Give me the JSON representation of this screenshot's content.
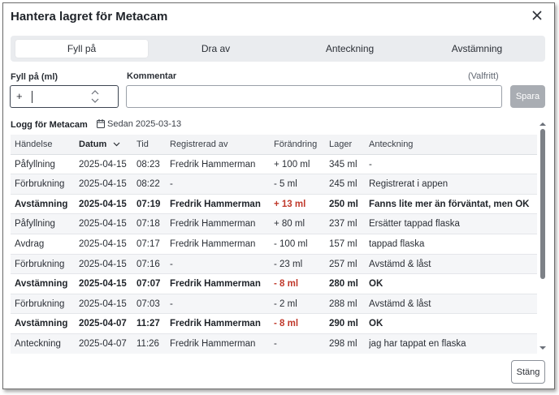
{
  "dialog": {
    "title": "Hantera lagret för Metacam",
    "close_label": "Stäng"
  },
  "tabs": [
    {
      "label": "Fyll på",
      "active": true
    },
    {
      "label": "Dra av",
      "active": false
    },
    {
      "label": "Anteckning",
      "active": false
    },
    {
      "label": "Avstämning",
      "active": false
    }
  ],
  "form": {
    "amount_label": "Fyll på (ml)",
    "amount_prefix": "+",
    "amount_value": "",
    "comment_label": "Kommentar",
    "comment_optional": "(Valfritt)",
    "comment_value": "",
    "save_label": "Spara"
  },
  "log": {
    "title": "Logg för Metacam",
    "since": "Sedan 2025-03-13",
    "columns": [
      "Händelse",
      "Datum",
      "Tid",
      "Registrerad av",
      "Förändring",
      "Lager",
      "Anteckning"
    ],
    "sorted_column": "Datum",
    "rows": [
      {
        "event": "Påfyllning",
        "date": "2025-04-15",
        "time": "08:23",
        "by": "Fredrik Hammerman",
        "change": "+ 100 ml",
        "stock": "345 ml",
        "note": "-",
        "bold": false,
        "negative": false
      },
      {
        "event": "Förbrukning",
        "date": "2025-04-15",
        "time": "08:22",
        "by": "-",
        "change": "- 5 ml",
        "stock": "245 ml",
        "note": "Registrerat i appen",
        "bold": false,
        "negative": false
      },
      {
        "event": "Avstämning",
        "date": "2025-04-15",
        "time": "07:19",
        "by": "Fredrik Hammerman",
        "change": "+ 13 ml",
        "stock": "250 ml",
        "note": "Fanns lite mer än förväntat, men OK",
        "bold": true,
        "negative": true
      },
      {
        "event": "Påfyllning",
        "date": "2025-04-15",
        "time": "07:18",
        "by": "Fredrik Hammerman",
        "change": "+ 80 ml",
        "stock": "237 ml",
        "note": "Ersätter tappad flaska",
        "bold": false,
        "negative": false
      },
      {
        "event": "Avdrag",
        "date": "2025-04-15",
        "time": "07:17",
        "by": "Fredrik Hammerman",
        "change": "- 100 ml",
        "stock": "157 ml",
        "note": "tappad flaska",
        "bold": false,
        "negative": false
      },
      {
        "event": "Förbrukning",
        "date": "2025-04-15",
        "time": "07:16",
        "by": "-",
        "change": "- 23 ml",
        "stock": "257 ml",
        "note": "Avstämd & låst",
        "bold": false,
        "negative": false
      },
      {
        "event": "Avstämning",
        "date": "2025-04-15",
        "time": "07:07",
        "by": "Fredrik Hammerman",
        "change": "- 8 ml",
        "stock": "280 ml",
        "note": "OK",
        "bold": true,
        "negative": true
      },
      {
        "event": "Förbrukning",
        "date": "2025-04-15",
        "time": "07:03",
        "by": "-",
        "change": "- 2 ml",
        "stock": "288 ml",
        "note": "Avstämd & låst",
        "bold": false,
        "negative": false
      },
      {
        "event": "Avstämning",
        "date": "2025-04-07",
        "time": "11:27",
        "by": "Fredrik Hammerman",
        "change": "- 8 ml",
        "stock": "290 ml",
        "note": "OK",
        "bold": true,
        "negative": true
      },
      {
        "event": "Anteckning",
        "date": "2025-04-07",
        "time": "11:26",
        "by": "Fredrik Hammerman",
        "change": "-",
        "stock": "298 ml",
        "note": "jag har tappat en flaska",
        "bold": false,
        "negative": false
      }
    ]
  },
  "colors": {
    "negative_change": "#c0392b",
    "tab_bar": "#eaecef",
    "save_disabled": "#a9adb3"
  },
  "icons": [
    "close-icon",
    "stepper-arrows-icon",
    "calendar-icon",
    "sort-chevron-icon",
    "scroll-up-icon",
    "scroll-down-icon"
  ]
}
